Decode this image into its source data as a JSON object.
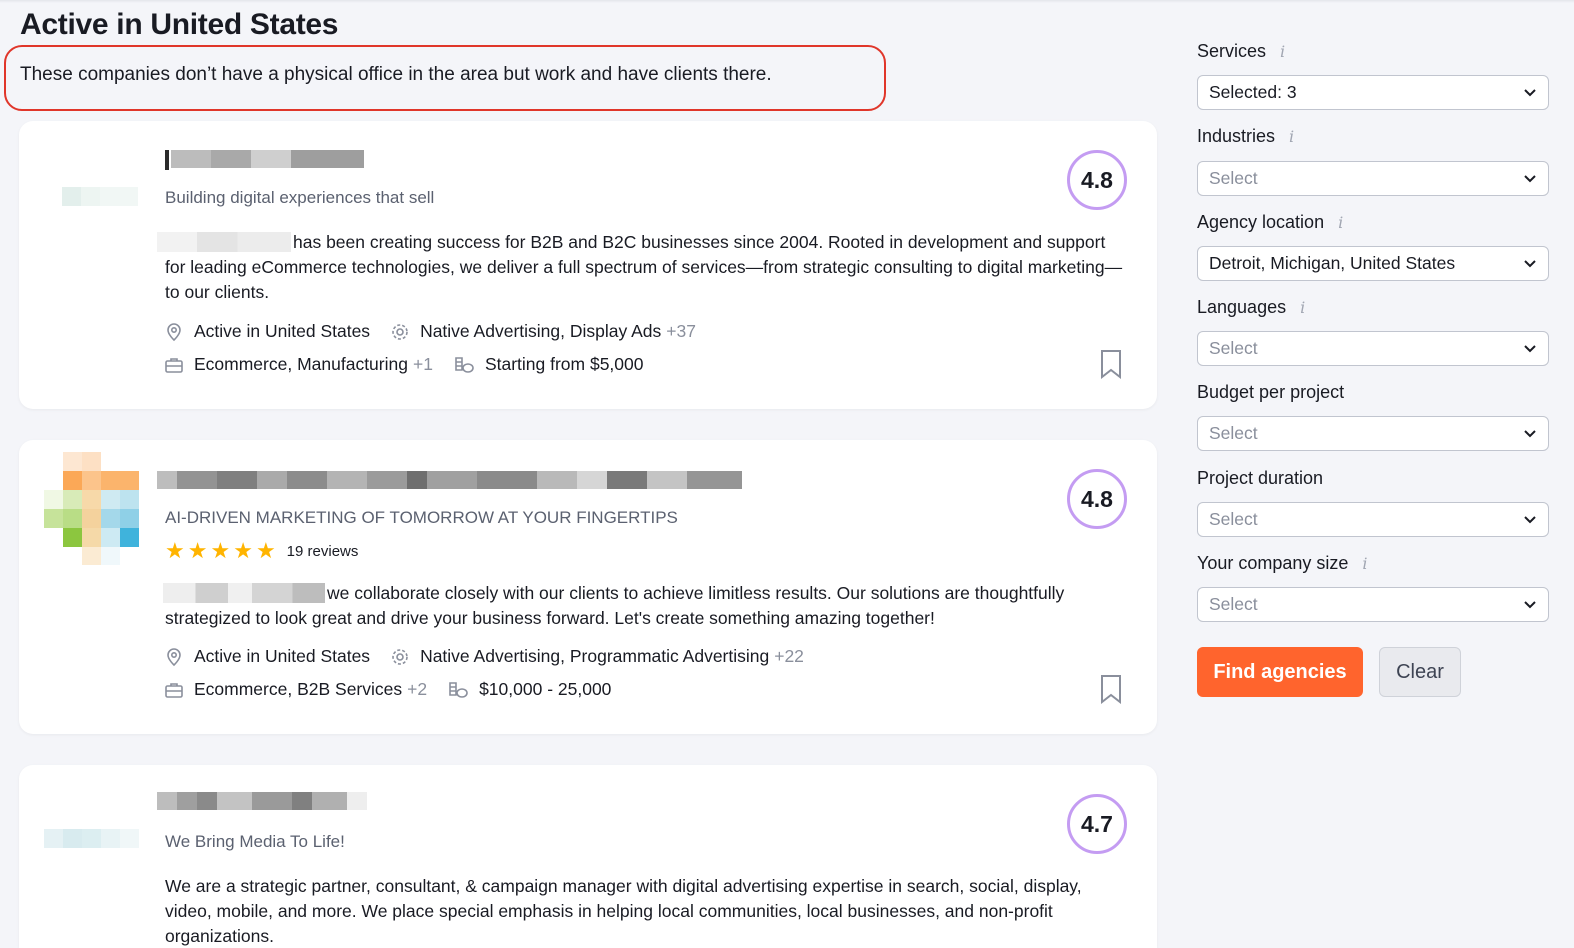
{
  "header": {
    "title": "Active in United States",
    "subtitle": "These companies don’t have a physical office in the area but work and have clients there."
  },
  "agencies": [
    {
      "tagline": "Building digital experiences that sell",
      "rating": "4.8",
      "description": "has been creating success for B2B and B2C businesses since 2004. Rooted in development and support for leading eCommerce technologies, we deliver a full spectrum of services—from strategic consulting to digital marketing—to our clients.",
      "location": "Active in United States",
      "services": "Native Advertising, Display Ads",
      "services_more": "+37",
      "industries": "Ecommerce, Manufacturing",
      "industries_more": "+1",
      "budget": "Starting from $5,000"
    },
    {
      "tagline": "AI-DRIVEN MARKETING OF TOMORROW AT YOUR FINGERTIPS",
      "rating": "4.8",
      "reviews": "19 reviews",
      "stars": 5,
      "description": "we collaborate closely with our clients to achieve limitless results. Our solutions are thoughtfully strategized to look great and drive your business forward. Let's create something amazing together!",
      "location": "Active in United States",
      "services": "Native Advertising, Programmatic Advertising",
      "services_more": "+22",
      "industries": "Ecommerce, B2B Services",
      "industries_more": "+2",
      "budget": "$10,000 - 25,000"
    },
    {
      "tagline": "We Bring Media To Life!",
      "rating": "4.7",
      "description": "We are a strategic partner, consultant, & campaign manager with digital advertising expertise in search, social, display, video, mobile, and more. We place special emphasis in helping local communities, local businesses, and non-profit organizations."
    }
  ],
  "filters": {
    "services": {
      "label": "Services",
      "value": "Selected: 3"
    },
    "industries": {
      "label": "Industries",
      "placeholder": "Select"
    },
    "agency_location": {
      "label": "Agency location",
      "value": "Detroit, Michigan, United States"
    },
    "languages": {
      "label": "Languages",
      "placeholder": "Select"
    },
    "budget": {
      "label": "Budget per project",
      "placeholder": "Select"
    },
    "duration": {
      "label": "Project duration",
      "placeholder": "Select"
    },
    "company_size": {
      "label": "Your company size",
      "placeholder": "Select"
    },
    "info_glyph": "i"
  },
  "actions": {
    "find_label": "Find agencies",
    "clear_label": "Clear"
  },
  "colors": {
    "accent": "#ff642d",
    "rating_ring": "#c49cf2",
    "star": "#ffb400",
    "highlight_box": "#e0362a"
  }
}
